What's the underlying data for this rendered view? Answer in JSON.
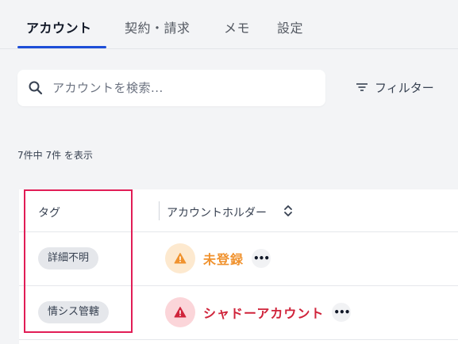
{
  "tabs": [
    {
      "label": "アカウント"
    },
    {
      "label": "契約・請求"
    },
    {
      "label": "メモ"
    },
    {
      "label": "設定"
    }
  ],
  "search": {
    "placeholder": "アカウントを検索..."
  },
  "filter": {
    "label": "フィルター"
  },
  "result_count": "7件中 7件 を表示",
  "table": {
    "columns": [
      "タグ",
      "アカウントホルダー"
    ],
    "rows": [
      {
        "tag": "詳細不明",
        "holder": "未登録",
        "status": "warning",
        "more": "•••"
      },
      {
        "tag": "情シス管轄",
        "holder": "シャドーアカウント",
        "status": "danger",
        "more": "•••"
      }
    ]
  },
  "colors": {
    "accent": "#1d4ed8",
    "warning_text": "#f0922e",
    "warning_bg": "#fde9cf",
    "danger_text": "#d0243b",
    "danger_bg": "#fbd5d9",
    "highlight": "#e11d56"
  },
  "icons": {
    "search": "search-icon",
    "filter": "filter-icon",
    "sort": "sort-updown-icon",
    "warning": "warning-triangle-icon",
    "danger": "danger-triangle-icon",
    "more": "ellipsis-icon"
  }
}
